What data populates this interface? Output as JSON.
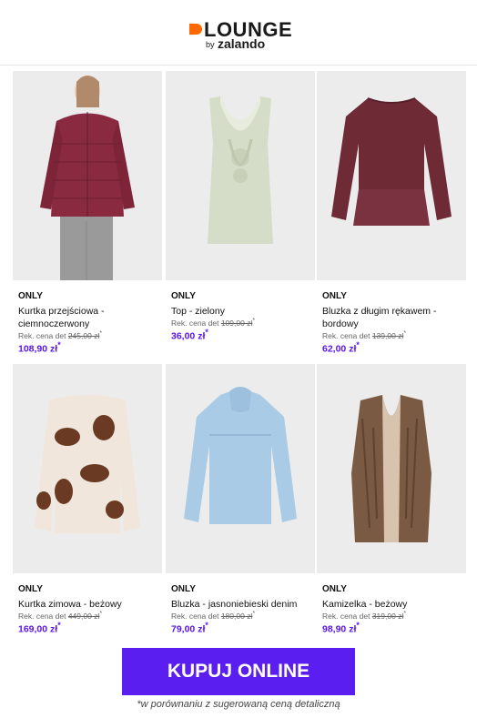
{
  "header": {
    "logo_word": "LOUNGE",
    "logo_by": "by",
    "logo_brand": "zalando",
    "logo_color": "#ff6900"
  },
  "products": [
    {
      "brand": "ONLY",
      "title": "Kurtka przejściowa - ciemnoczerwony",
      "rrp_label": "Rek. cena det",
      "rrp": "245,00 zł",
      "rrp_suffix": "*",
      "price": "108,90 zł",
      "price_suffix": "*",
      "image": "jacket-icon",
      "color": "#8a2a40"
    },
    {
      "brand": "ONLY",
      "title": "Top - zielony",
      "rrp_label": "Rek. cena det",
      "rrp": "109,00 zł",
      "rrp_suffix": "*",
      "price": "36,00 zł",
      "price_suffix": "*",
      "image": "top-icon",
      "color": "#d5ddc8"
    },
    {
      "brand": "ONLY",
      "title": "Bluzka z długim rękawem - bordowy",
      "rrp_label": "Rek. cena det",
      "rrp": "139,00 zł",
      "rrp_suffix": "*",
      "price": "62,00 zł",
      "price_suffix": "*",
      "image": "blouse-icon",
      "color": "#6e2a35"
    },
    {
      "brand": "ONLY",
      "title": "Kurtka zimowa - beżowy",
      "rrp_label": "Rek. cena det",
      "rrp": "449,00 zł",
      "rrp_suffix": "*",
      "price": "169,00 zł",
      "price_suffix": "*",
      "image": "fur-coat-icon",
      "color": "#f0e6dc"
    },
    {
      "brand": "ONLY",
      "title": "Bluzka - jasnoniebieski denim",
      "rrp_label": "Rek. cena det",
      "rrp": "180,00 zł",
      "rrp_suffix": "*",
      "price": "79,00 zł",
      "price_suffix": "*",
      "image": "shirt-icon",
      "color": "#a9cbe6"
    },
    {
      "brand": "ONLY",
      "title": "Kamizelka - beżowy",
      "rrp_label": "Rek. cena det",
      "rrp": "319,00 zł",
      "rrp_suffix": "*",
      "price": "98,90 zł",
      "price_suffix": "*",
      "image": "vest-icon",
      "color": "#7a5a42"
    }
  ],
  "cta": {
    "label": "KUPUJ ONLINE",
    "color": "#5a1ff0"
  },
  "footnote": "*w porównaniu z sugerowaną ceną detaliczną"
}
